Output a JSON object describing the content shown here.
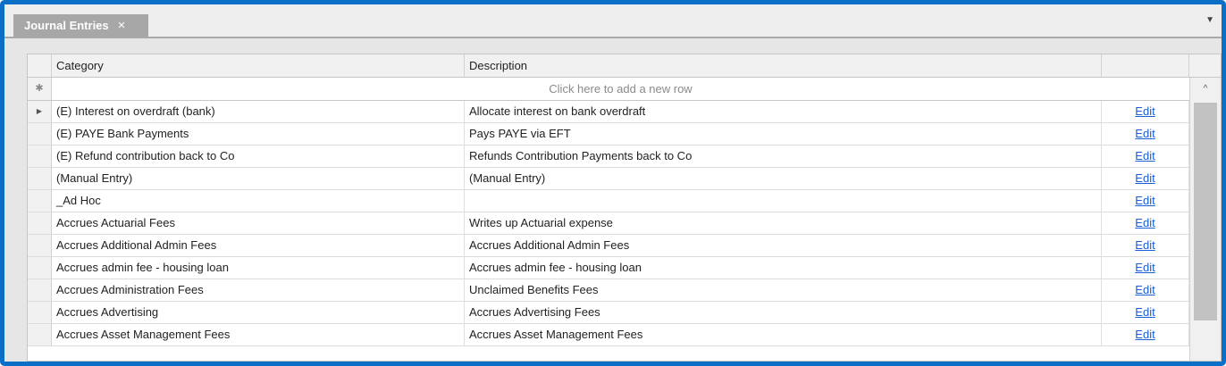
{
  "tab": {
    "title": "Journal Entries",
    "close_glyph": "×",
    "menu_glyph": "▼"
  },
  "grid": {
    "columns": {
      "category": "Category",
      "description": "Description"
    },
    "new_row": {
      "indicator": "✱",
      "text": "Click here to add a new row"
    },
    "edit_label": "Edit",
    "rows": [
      {
        "category": "(E) Interest on overdraft (bank)",
        "description": "Allocate interest on bank overdraft"
      },
      {
        "category": "(E) PAYE Bank Payments",
        "description": "Pays PAYE via EFT"
      },
      {
        "category": "(E) Refund contribution back to Co",
        "description": "Refunds Contribution Payments back to Co"
      },
      {
        "category": "(Manual Entry)",
        "description": "(Manual Entry)"
      },
      {
        "category": "_Ad Hoc",
        "description": ""
      },
      {
        "category": "Accrues Actuarial Fees",
        "description": "Writes up Actuarial expense"
      },
      {
        "category": "Accrues Additional Admin Fees",
        "description": "Accrues Additional Admin Fees"
      },
      {
        "category": "Accrues admin fee - housing loan",
        "description": "Accrues admin fee - housing loan"
      },
      {
        "category": "Accrues Administration Fees",
        "description": "Unclaimed Benefits Fees"
      },
      {
        "category": "Accrues Advertising",
        "description": "Accrues Advertising Fees"
      },
      {
        "category": "Accrues Asset Management Fees",
        "description": "Accrues Asset Management Fees"
      }
    ],
    "current_row_glyph": "▶",
    "scroll_up_glyph": "^"
  }
}
